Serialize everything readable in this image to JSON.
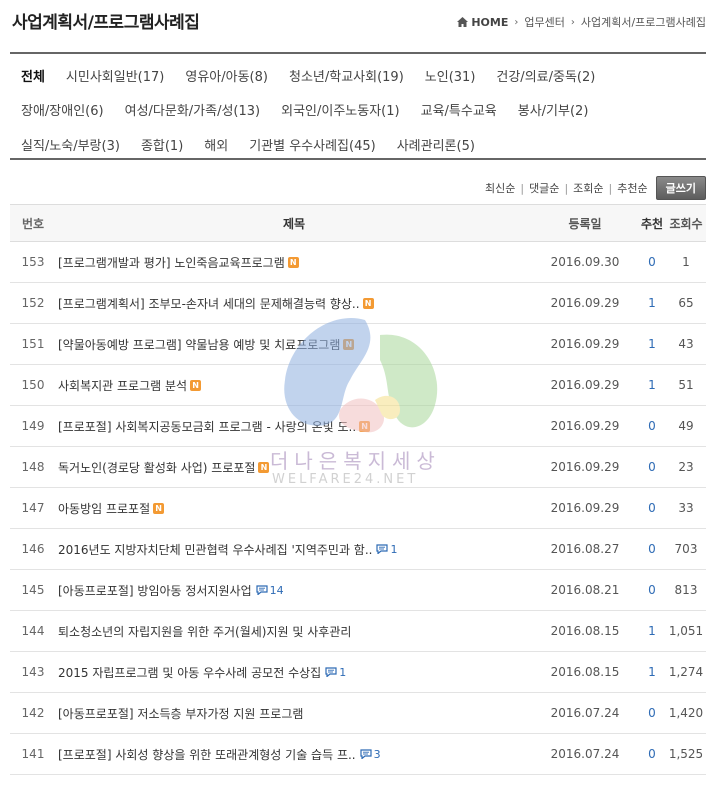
{
  "header": {
    "title": "사업계획서/프로그램사례집",
    "breadcrumb": [
      "HOME",
      "업무센터",
      "사업계획서/프로그램사례집"
    ]
  },
  "categories": {
    "row1": [
      "전체",
      "시민사회일반(17)",
      "영유아/아동(8)",
      "청소년/학교사회(19)",
      "노인(31)",
      "건강/의료/중독(2)"
    ],
    "row2": [
      "장애/장애인(6)",
      "여성/다문화/가족/성(13)",
      "외국인/이주노동자(1)",
      "교육/특수교육",
      "봉사/기부(2)"
    ],
    "row3": [
      "실직/노숙/부랑(3)",
      "종합(1)",
      "해외",
      "기관별 우수사례집(45)",
      "사례관리론(5)"
    ]
  },
  "sort": {
    "options": [
      "최신순",
      "댓글순",
      "조회순",
      "추천순"
    ],
    "write_label": "글쓰기"
  },
  "table": {
    "headers": {
      "num": "번호",
      "title": "제목",
      "date": "등록일",
      "rec": "추천",
      "views": "조회수"
    },
    "rows": [
      {
        "num": "153",
        "title": "[프로그램개발과 평가] 노인죽음교육프로그램",
        "new": "N",
        "comments": "",
        "date": "2016.09.30",
        "rec": "0",
        "views": "1"
      },
      {
        "num": "152",
        "title": "[프로그램계획서] 조부모-손자녀 세대의 문제해결능력 향상..",
        "new": "N",
        "comments": "",
        "date": "2016.09.29",
        "rec": "1",
        "views": "65"
      },
      {
        "num": "151",
        "title": "[약물아동예방 프로그램] 약물남용 예방 및 치료프로그램",
        "new": "N",
        "comments": "",
        "date": "2016.09.29",
        "rec": "1",
        "views": "43"
      },
      {
        "num": "150",
        "title": "사회복지관 프로그램 분석",
        "new": "N",
        "comments": "",
        "date": "2016.09.29",
        "rec": "1",
        "views": "51"
      },
      {
        "num": "149",
        "title": "[프로포절] 사회복지공동모금회 프로그램 - 사랑의 온빛 도..",
        "new": "N",
        "comments": "",
        "date": "2016.09.29",
        "rec": "0",
        "views": "49"
      },
      {
        "num": "148",
        "title": "독거노인(경로당 활성화 사업) 프로포절",
        "new": "N",
        "comments": "",
        "date": "2016.09.29",
        "rec": "0",
        "views": "23"
      },
      {
        "num": "147",
        "title": "아동방임 프로포절",
        "new": "N",
        "comments": "",
        "date": "2016.09.29",
        "rec": "0",
        "views": "33"
      },
      {
        "num": "146",
        "title": "2016년도 지방자치단체 민관협력 우수사례집 '지역주민과 함..",
        "new": "",
        "comments": "1",
        "date": "2016.08.27",
        "rec": "0",
        "views": "703"
      },
      {
        "num": "145",
        "title": "[아동프로포절] 방임아동 정서지원사업",
        "new": "",
        "comments": "14",
        "date": "2016.08.21",
        "rec": "0",
        "views": "813"
      },
      {
        "num": "144",
        "title": "퇴소청소년의 자립지원을 위한 주거(월세)지원 및 사후관리",
        "new": "",
        "comments": "",
        "date": "2016.08.15",
        "rec": "1",
        "views": "1,051"
      },
      {
        "num": "143",
        "title": "2015 자립프로그램 및 아동 우수사례 공모전 수상집",
        "new": "",
        "comments": "1",
        "date": "2016.08.15",
        "rec": "1",
        "views": "1,274"
      },
      {
        "num": "142",
        "title": "[아동프로포절] 저소득층 부자가정 지원 프로그램",
        "new": "",
        "comments": "",
        "date": "2016.07.24",
        "rec": "0",
        "views": "1,420"
      },
      {
        "num": "141",
        "title": "[프로포절] 사회성 향상을 위한 또래관계형성 기술 습득 프..",
        "new": "",
        "comments": "3",
        "date": "2016.07.24",
        "rec": "0",
        "views": "1,525"
      }
    ]
  },
  "watermark": {
    "line1": "더나은복지세상",
    "line2": "WELFARE24.NET"
  },
  "colors": {
    "accent": "#2e6bb5",
    "new_badge": "#f39a33",
    "border": "#666666"
  }
}
